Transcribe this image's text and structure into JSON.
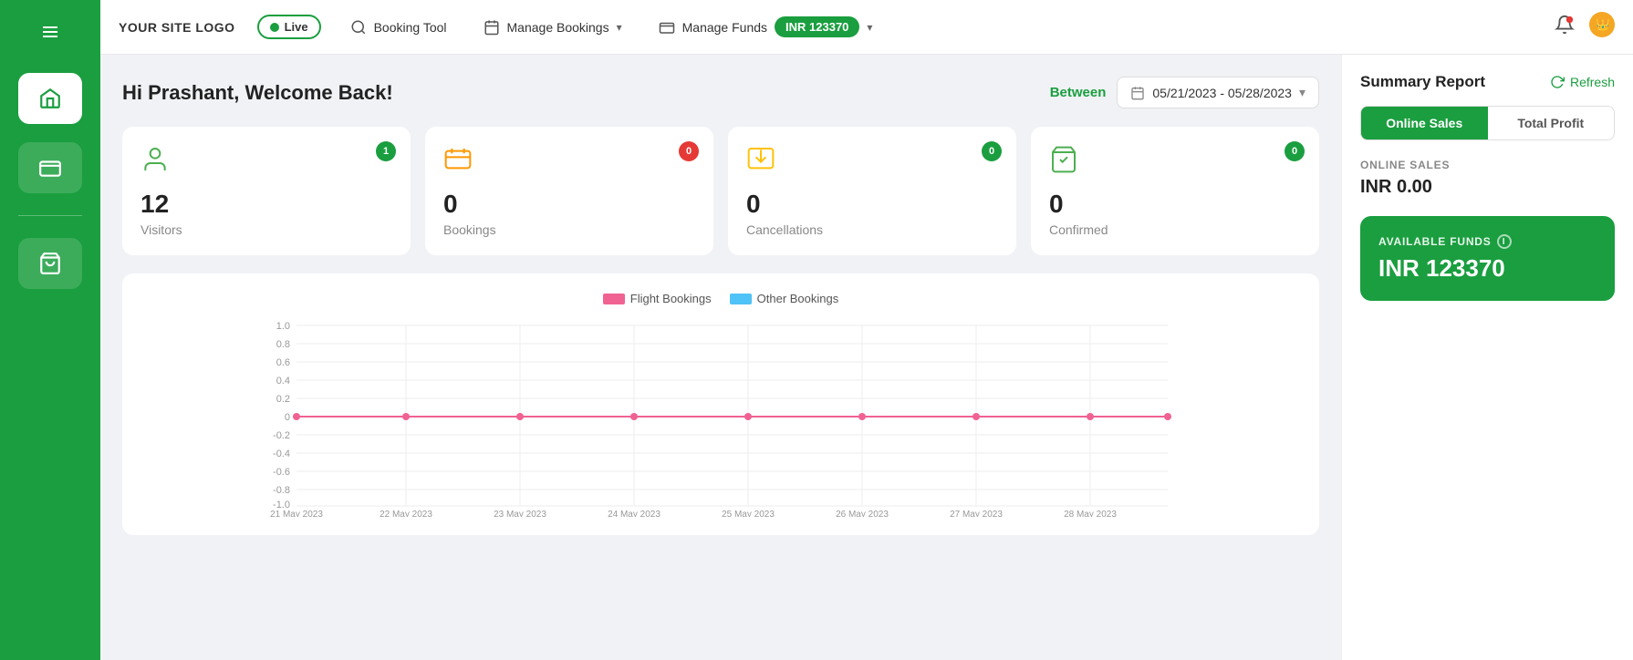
{
  "sidebar": {
    "items": [
      {
        "label": "home",
        "icon": "home",
        "active": true
      },
      {
        "label": "wallet",
        "icon": "wallet",
        "active": false
      },
      {
        "label": "shopping",
        "icon": "shopping",
        "active": false
      }
    ]
  },
  "topnav": {
    "logo": "YOUR SITE LOGO",
    "live_label": "Live",
    "booking_tool": "Booking Tool",
    "manage_bookings": "Manage Bookings",
    "manage_funds": "Manage Funds",
    "funds_amount": "INR 123370"
  },
  "dashboard": {
    "welcome": "Hi Prashant, Welcome Back!",
    "between_label": "Between",
    "date_range": "05/21/2023 - 05/28/2023",
    "stats": [
      {
        "label": "Visitors",
        "value": "12",
        "badge": "1",
        "badge_type": "green"
      },
      {
        "label": "Bookings",
        "value": "0",
        "badge": "0",
        "badge_type": "red"
      },
      {
        "label": "Cancellations",
        "value": "0",
        "badge": "0",
        "badge_type": "green"
      },
      {
        "label": "Confirmed",
        "value": "0",
        "badge": "0",
        "badge_type": "green"
      }
    ],
    "chart": {
      "legend": [
        {
          "label": "Flight Bookings",
          "color": "#f06292"
        },
        {
          "label": "Other Bookings",
          "color": "#4fc3f7"
        }
      ],
      "x_labels": [
        "21 May 2023",
        "22 May 2023",
        "23 May 2023",
        "24 May 2023",
        "25 May 2023",
        "26 May 2023",
        "27 May 2023",
        "28 May 2023"
      ],
      "y_labels": [
        "1.0",
        "0.8",
        "0.6",
        "0.4",
        "0.2",
        "0",
        "-0.2",
        "-0.4",
        "-0.6",
        "-0.8",
        "-1.0"
      ]
    }
  },
  "summary": {
    "title": "Summary Report",
    "refresh_label": "Refresh",
    "tabs": [
      {
        "label": "Online Sales",
        "active": true
      },
      {
        "label": "Total Profit",
        "active": false
      }
    ],
    "online_sales_label": "ONLINE SALES",
    "online_sales_value": "INR 0.00",
    "available_funds_label": "AVAILABLE FUNDS",
    "available_funds_value": "INR 123370"
  }
}
